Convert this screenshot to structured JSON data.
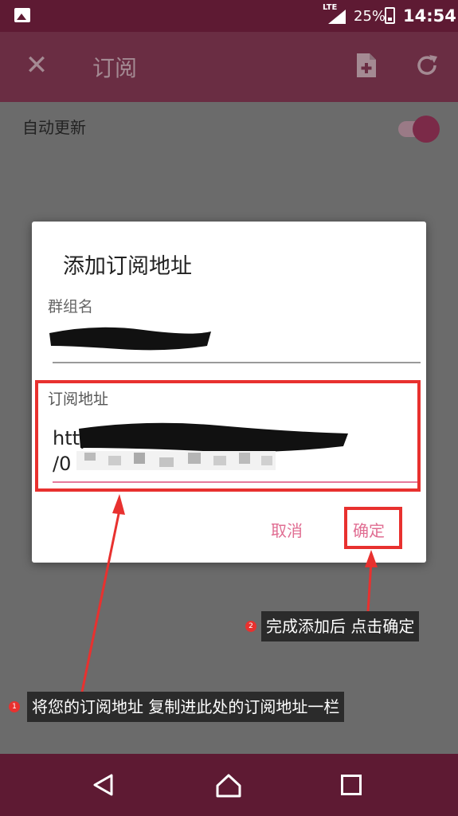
{
  "status_bar": {
    "network": "LTE",
    "battery": "25%",
    "time": "14:54",
    "icons": [
      "image-icon",
      "signal-icon",
      "battery-icon"
    ]
  },
  "app_bar": {
    "title": "订阅",
    "icons": [
      "close-icon",
      "new-file-icon",
      "refresh-icon"
    ]
  },
  "settings": {
    "auto_update_label": "自动更新",
    "auto_update_on": true
  },
  "dialog": {
    "title": "添加订阅地址",
    "group_label": "群组名",
    "url_label": "订阅地址",
    "url_value_line1": "https://www.",
    "url_value_line2": "/0",
    "cancel_label": "取消",
    "ok_label": "确定"
  },
  "annotations": {
    "step1_number": "1",
    "step1_text": "将您的订阅地址 复制进此处的订阅地址一栏",
    "step2_number": "2",
    "step2_text": "完成添加后 点击确定"
  },
  "colors": {
    "primary_dark": "#5e1a33",
    "accent": "#e06d92",
    "annotation_red": "#e8312f"
  },
  "nav_bar": {
    "icons": [
      "back-icon",
      "home-icon",
      "recent-apps-icon"
    ]
  }
}
